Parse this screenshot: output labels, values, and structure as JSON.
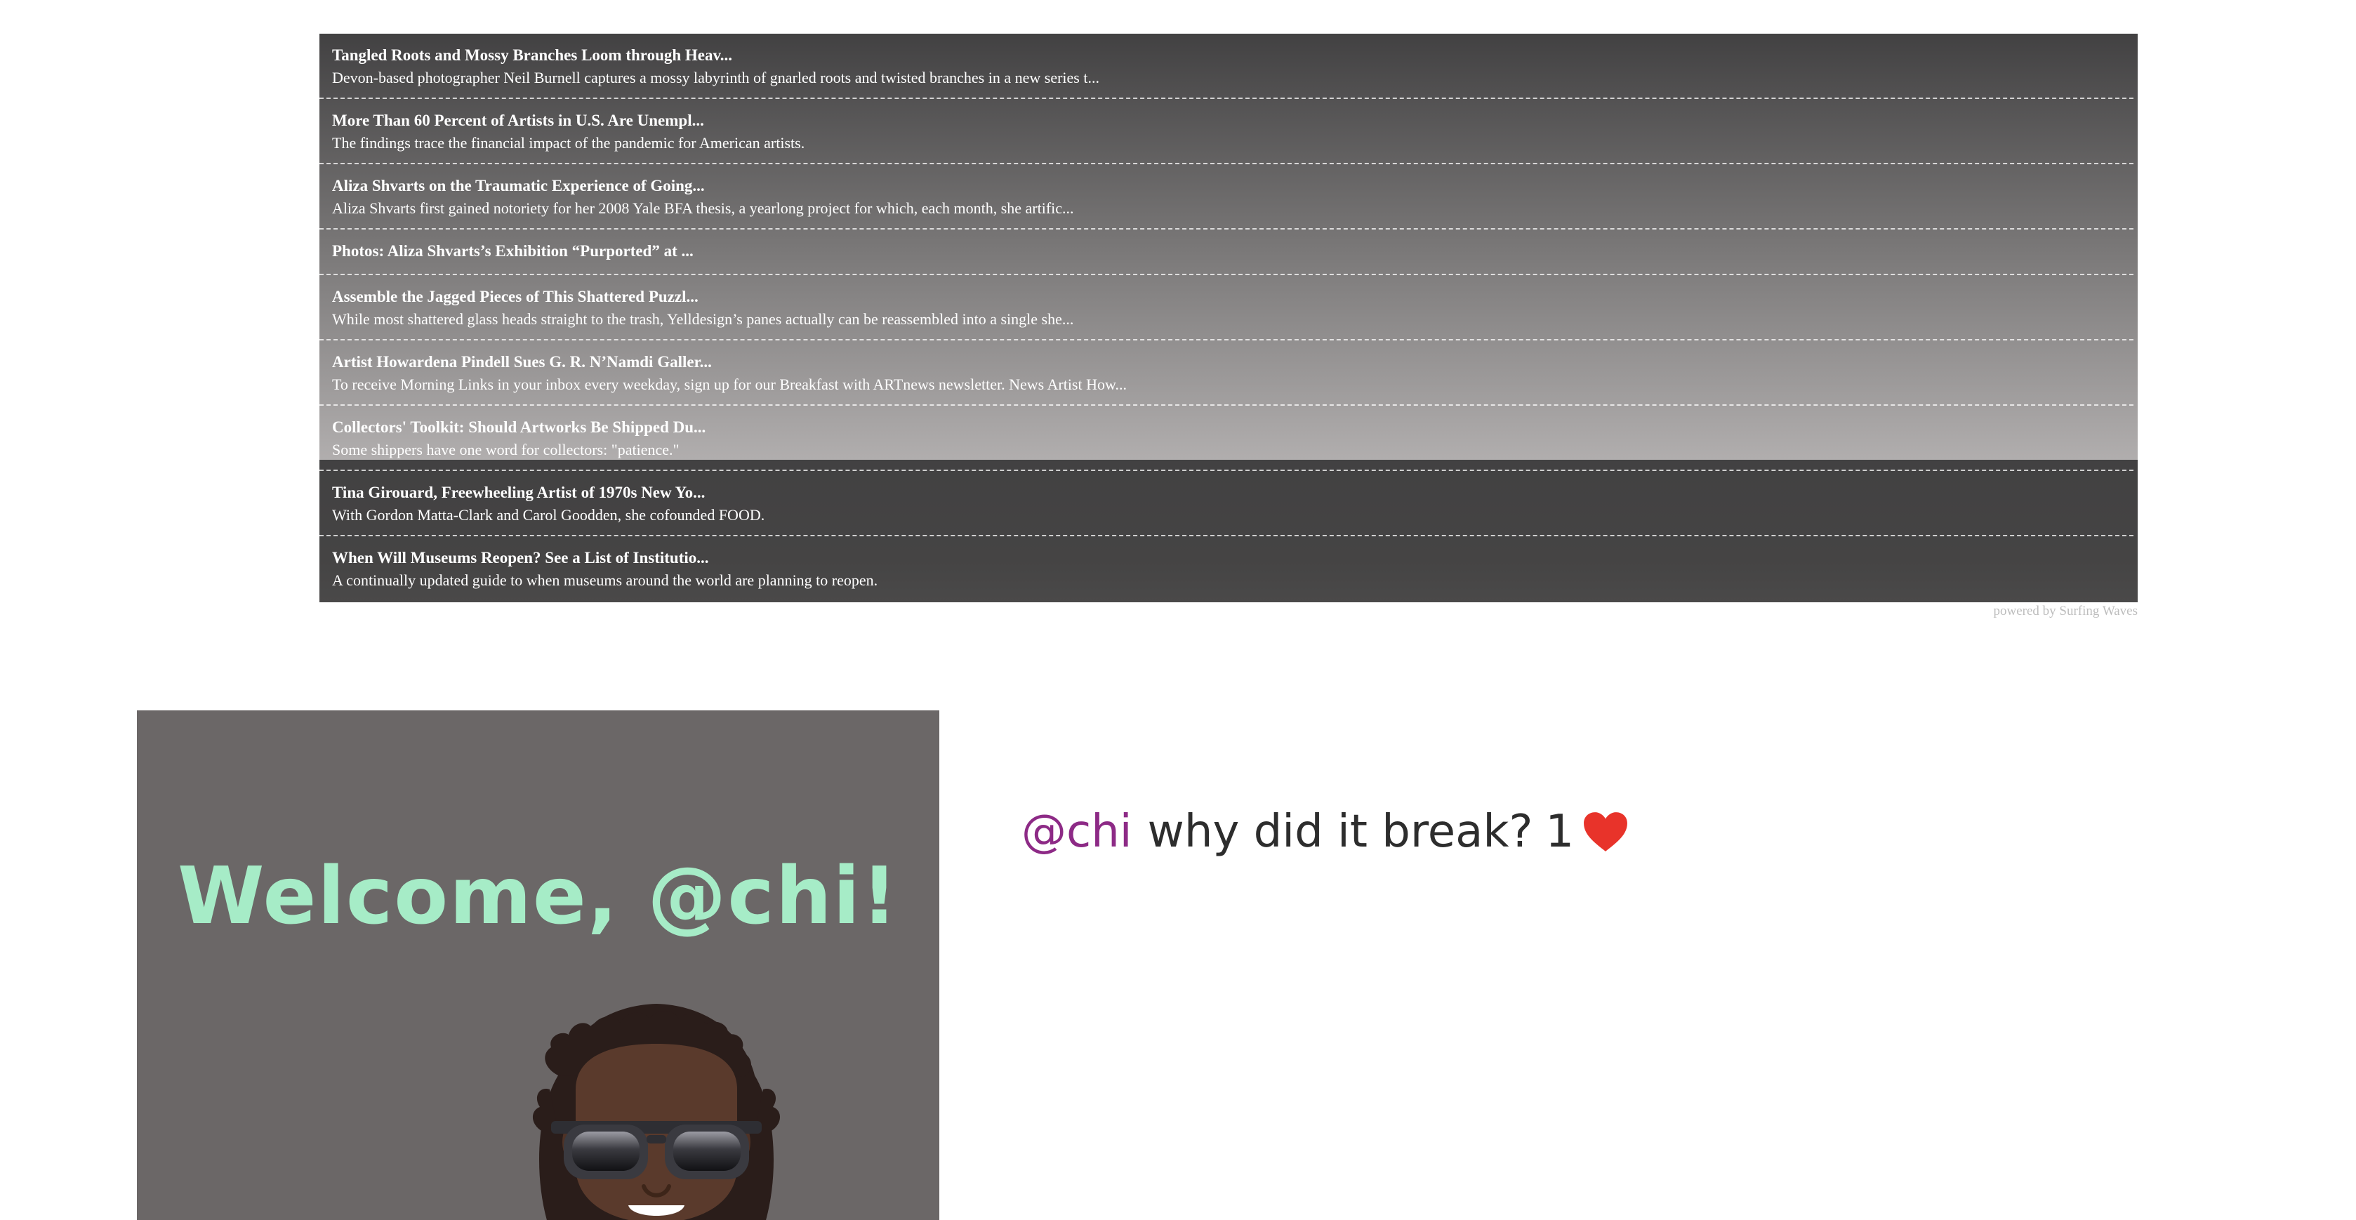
{
  "feed": {
    "items": [
      {
        "title": "Tangled Roots and Mossy Branches Loom through Heav...",
        "desc": "Devon-based photographer Neil Burnell captures a mossy labyrinth of gnarled roots and twisted branches in a new series t..."
      },
      {
        "title": "More Than 60 Percent of Artists in U.S. Are Unempl...",
        "desc": "The findings trace the financial impact of the pandemic for American artists."
      },
      {
        "title": "Aliza Shvarts on the Traumatic Experience of Going...",
        "desc": "Aliza Shvarts first gained notoriety for her 2008 Yale BFA thesis, a yearlong project for which, each month, she artific..."
      },
      {
        "title": "Photos: Aliza Shvarts’s Exhibition “Purported” at ...",
        "desc": ""
      },
      {
        "title": "Assemble the Jagged Pieces of This Shattered Puzzl...",
        "desc": "While most shattered glass heads straight to the trash, Yelldesign’s panes actually can be reassembled into a single she..."
      },
      {
        "title": "Artist Howardena Pindell Sues G. R. N’Namdi Galler...",
        "desc": "To receive Morning Links in your inbox every weekday, sign up for our Breakfast with ARTnews newsletter. News Artist How..."
      },
      {
        "title": "Collectors' Toolkit: Should Artworks Be Shipped Du...",
        "desc": "Some shippers have one word for collectors: \"patience.\""
      },
      {
        "title": "Tina Girouard, Freewheeling Artist of 1970s New Yo...",
        "desc": "With Gordon Matta-Clark and Carol Goodden, she cofounded FOOD."
      },
      {
        "title": "When Will Museums Reopen? See a List of Institutio...",
        "desc": "A continually updated guide to when museums around the world are planning to reopen."
      }
    ],
    "powered_by": "powered by Surfing Waves"
  },
  "welcome": {
    "title": "Welcome, @chi!",
    "avatar_icon": "bitmoji-avatar-sunglasses"
  },
  "post": {
    "username": "@chi",
    "text": "why did it break?",
    "like_count": "1",
    "like_icon": "heart-icon",
    "heart_color": "#e8332a"
  },
  "colors": {
    "username": "#8d2a86",
    "welcome_title": "#a6ecc7",
    "card_bg": "#6b6767"
  }
}
